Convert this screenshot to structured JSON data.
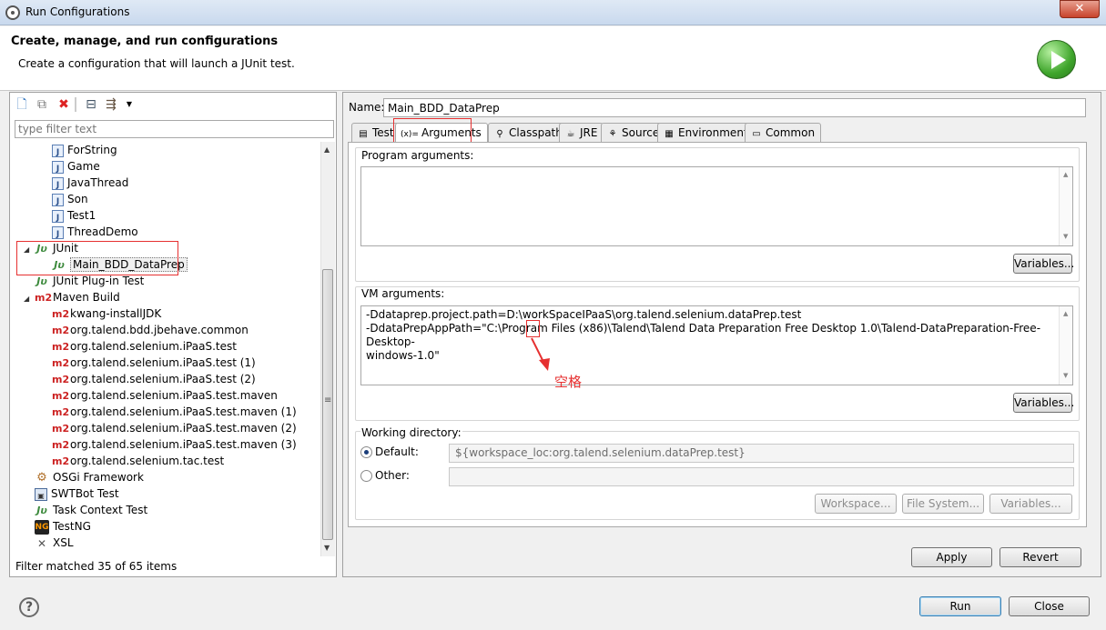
{
  "window": {
    "title": "Run Configurations",
    "close_label": "✕"
  },
  "header": {
    "title": "Create, manage, and run configurations",
    "description": "Create a configuration that will launch a JUnit test."
  },
  "left": {
    "filter_placeholder": "type filter text",
    "toolbar": [
      "new-config-icon",
      "duplicate-icon",
      "delete-icon",
      "collapse-all-icon",
      "filter-icon",
      "dropdown-icon"
    ],
    "tree": [
      {
        "label": "ForString",
        "icon": "java-icon",
        "indent": 2
      },
      {
        "label": "Game",
        "icon": "java-icon",
        "indent": 2
      },
      {
        "label": "JavaThread",
        "icon": "java-icon",
        "indent": 2
      },
      {
        "label": "Son",
        "icon": "java-icon",
        "indent": 2
      },
      {
        "label": "Test1",
        "icon": "java-icon",
        "indent": 2
      },
      {
        "label": "ThreadDemo",
        "icon": "java-icon",
        "indent": 2
      },
      {
        "label": "JUnit",
        "icon": "junit-icon",
        "indent": 1,
        "expanded": true
      },
      {
        "label": "Main_BDD_DataPrep",
        "icon": "junit-icon",
        "indent": 2,
        "selected": true
      },
      {
        "label": "JUnit Plug-in Test",
        "icon": "junit-icon",
        "indent": 1
      },
      {
        "label": "Maven Build",
        "icon": "m2-icon",
        "indent": 1,
        "expanded": true
      },
      {
        "label": "kwang-installJDK",
        "icon": "m2-icon",
        "indent": 2
      },
      {
        "label": "org.talend.bdd.jbehave.common",
        "icon": "m2-icon",
        "indent": 2
      },
      {
        "label": "org.talend.selenium.iPaaS.test",
        "icon": "m2-icon",
        "indent": 2
      },
      {
        "label": "org.talend.selenium.iPaaS.test (1)",
        "icon": "m2-icon",
        "indent": 2
      },
      {
        "label": "org.talend.selenium.iPaaS.test (2)",
        "icon": "m2-icon",
        "indent": 2
      },
      {
        "label": "org.talend.selenium.iPaaS.test.maven",
        "icon": "m2-icon",
        "indent": 2
      },
      {
        "label": "org.talend.selenium.iPaaS.test.maven (1)",
        "icon": "m2-icon",
        "indent": 2
      },
      {
        "label": "org.talend.selenium.iPaaS.test.maven (2)",
        "icon": "m2-icon",
        "indent": 2
      },
      {
        "label": "org.talend.selenium.iPaaS.test.maven (3)",
        "icon": "m2-icon",
        "indent": 2
      },
      {
        "label": "org.talend.selenium.tac.test",
        "icon": "m2-icon",
        "indent": 2
      },
      {
        "label": "OSGi Framework",
        "icon": "osgi-icon",
        "indent": 1
      },
      {
        "label": "SWTBot Test",
        "icon": "swtbot-icon",
        "indent": 1
      },
      {
        "label": "Task Context Test",
        "icon": "junit-icon",
        "indent": 1
      },
      {
        "label": "TestNG",
        "icon": "testng-icon",
        "indent": 1
      },
      {
        "label": "XSL",
        "icon": "xsl-icon",
        "indent": 1
      }
    ],
    "status": "Filter matched 35 of 65 items"
  },
  "right": {
    "name_label": "Name:",
    "name_value": "Main_BDD_DataPrep",
    "tabs": [
      {
        "label": "Test",
        "icon": "test-tab-icon"
      },
      {
        "label": "Arguments",
        "icon": "arguments-tab-icon",
        "prefix": "(x)=",
        "active": true
      },
      {
        "label": "Classpath",
        "icon": "classpath-tab-icon"
      },
      {
        "label": "JRE",
        "icon": "jre-tab-icon"
      },
      {
        "label": "Source",
        "icon": "source-tab-icon"
      },
      {
        "label": "Environment",
        "icon": "environment-tab-icon"
      },
      {
        "label": "Common",
        "icon": "common-tab-icon"
      }
    ],
    "program_args": {
      "label": "Program arguments:",
      "value": "",
      "variables_btn": "Variables..."
    },
    "vm_args": {
      "label": "VM arguments:",
      "lines": [
        "-Ddataprep.project.path=D:\\workSpaceIPaaS\\org.talend.selenium.dataPrep.test",
        "-DdataPrepAppPath=\"C:\\Program Files (x86)\\Talend\\Talend Data Preparation Free Desktop 1.0\\Talend-DataPreparation-Free-Desktop-",
        "windows-1.0\""
      ],
      "variables_btn": "Variables..."
    },
    "working_dir": {
      "label": "Working directory:",
      "default_label": "Default:",
      "default_value": "${workspace_loc:org.talend.selenium.dataPrep.test}",
      "other_label": "Other:",
      "other_value": "",
      "workspace_btn": "Workspace...",
      "filesystem_btn": "File System...",
      "variables_btn": "Variables..."
    },
    "apply_btn": "Apply",
    "revert_btn": "Revert"
  },
  "annotation": {
    "text": "空格"
  },
  "footer": {
    "run_btn": "Run",
    "close_btn": "Close"
  }
}
